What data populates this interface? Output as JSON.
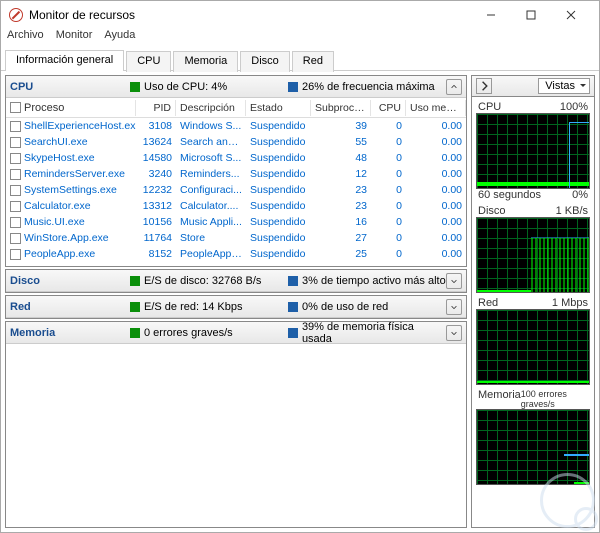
{
  "window": {
    "title": "Monitor de recursos"
  },
  "menu": {
    "file": "Archivo",
    "monitor": "Monitor",
    "help": "Ayuda"
  },
  "tabs": {
    "general": "Información general",
    "cpu": "CPU",
    "memory": "Memoria",
    "disk": "Disco",
    "network": "Red"
  },
  "panels": {
    "cpu": {
      "name": "CPU",
      "stat1": "Uso de CPU: 4%",
      "stat2": "26% de frecuencia máxima"
    },
    "disk": {
      "name": "Disco",
      "stat1": "E/S de disco: 32768 B/s",
      "stat2": "3% de tiempo activo más alto"
    },
    "net": {
      "name": "Red",
      "stat1": "E/S de red: 14 Kbps",
      "stat2": "0% de uso de red"
    },
    "mem": {
      "name": "Memoria",
      "stat1": "0 errores graves/s",
      "stat2": "39% de memoria física usada"
    }
  },
  "columns": {
    "proc": "Proceso",
    "pid": "PID",
    "desc": "Descripción",
    "status": "Estado",
    "threads": "Subprocesos",
    "cpu": "CPU",
    "avg": "Uso medio ..."
  },
  "rows": [
    {
      "proc": "ShellExperienceHost.exe",
      "pid": "3108",
      "desc": "Windows S...",
      "status": "Suspendido",
      "threads": "39",
      "cpu": "0",
      "avg": "0.00"
    },
    {
      "proc": "SearchUI.exe",
      "pid": "13624",
      "desc": "Search and...",
      "status": "Suspendido",
      "threads": "55",
      "cpu": "0",
      "avg": "0.00"
    },
    {
      "proc": "SkypeHost.exe",
      "pid": "14580",
      "desc": "Microsoft S...",
      "status": "Suspendido",
      "threads": "48",
      "cpu": "0",
      "avg": "0.00"
    },
    {
      "proc": "RemindersServer.exe",
      "pid": "3240",
      "desc": "Reminders...",
      "status": "Suspendido",
      "threads": "12",
      "cpu": "0",
      "avg": "0.00"
    },
    {
      "proc": "SystemSettings.exe",
      "pid": "12232",
      "desc": "Configuraci...",
      "status": "Suspendido",
      "threads": "23",
      "cpu": "0",
      "avg": "0.00"
    },
    {
      "proc": "Calculator.exe",
      "pid": "13312",
      "desc": "Calculator....",
      "status": "Suspendido",
      "threads": "23",
      "cpu": "0",
      "avg": "0.00"
    },
    {
      "proc": "Music.UI.exe",
      "pid": "10156",
      "desc": "Music Appli...",
      "status": "Suspendido",
      "threads": "16",
      "cpu": "0",
      "avg": "0.00"
    },
    {
      "proc": "WinStore.App.exe",
      "pid": "11764",
      "desc": "Store",
      "status": "Suspendido",
      "threads": "27",
      "cpu": "0",
      "avg": "0.00"
    },
    {
      "proc": "PeopleApp.exe",
      "pid": "8152",
      "desc": "PeopleApp....",
      "status": "Suspendido",
      "threads": "25",
      "cpu": "0",
      "avg": "0.00"
    }
  ],
  "right": {
    "views": "Vistas"
  },
  "graphs": {
    "cpu": {
      "title": "CPU",
      "max": "100%",
      "xlabel": "60 segundos",
      "xend": "0%"
    },
    "disk": {
      "title": "Disco",
      "max": "1 KB/s",
      "xlabel": "",
      "xend": ""
    },
    "net": {
      "title": "Red",
      "max": "1 Mbps",
      "xlabel": "",
      "xend": ""
    },
    "mem": {
      "title": "Memoria",
      "max": "100 errores graves/s",
      "xlabel": "",
      "xend": ""
    }
  }
}
